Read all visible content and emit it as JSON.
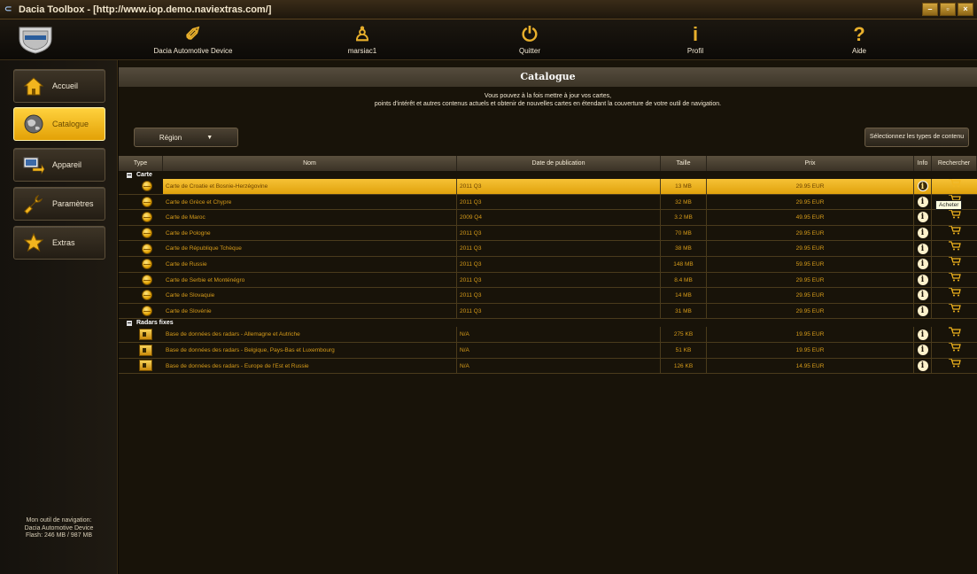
{
  "window": {
    "title": "Dacia Toolbox - [http://www.iop.demo.naviextras.com/]"
  },
  "toolbar": {
    "items": [
      {
        "label": "Dacia Automotive Device",
        "icon": "device-icon"
      },
      {
        "label": "marsiac1",
        "icon": "user-icon"
      },
      {
        "label": "Quitter",
        "icon": "power-icon"
      },
      {
        "label": "Profil",
        "icon": "info-icon"
      },
      {
        "label": "Aide",
        "icon": "help-icon"
      }
    ]
  },
  "sidebar": {
    "items": [
      {
        "label": "Accueil",
        "icon": "home-icon"
      },
      {
        "label": "Catalogue",
        "icon": "globe-icon",
        "active": true
      },
      {
        "label": "Appareil",
        "icon": "device-transfer-icon"
      },
      {
        "label": "Paramètres",
        "icon": "wrench-icon"
      },
      {
        "label": "Extras",
        "icon": "star-icon"
      }
    ],
    "device_info": {
      "line1": "Mon outil de navigation:",
      "line2": "Dacia Automotive Device",
      "line3": "Flash: 246 MB / 987 MB"
    }
  },
  "main": {
    "title": "Catalogue",
    "intro_line1": "Vous pouvez à la fois mettre à jour vos cartes,",
    "intro_line2": "points d'intérêt et autres contenus actuels et obtenir de nouvelles cartes en étendant la couverture de votre outil de navigation.",
    "region_button": "Région",
    "content_type_button": "Sélectionnez les types de contenu"
  },
  "table": {
    "columns": [
      "Type",
      "Nom",
      "Date de publication",
      "Taille",
      "Prix",
      "Info",
      "Rechercher"
    ],
    "groups": [
      {
        "label": "Carte",
        "rows": [
          {
            "name": "Carte de Croatie et Bosnie-Herzégovine",
            "date": "2011 Q3",
            "size": "13 MB",
            "price": "29.95 EUR",
            "selected": true
          },
          {
            "name": "Carte de Grèce et Chypre",
            "date": "2011 Q3",
            "size": "32 MB",
            "price": "29.95 EUR"
          },
          {
            "name": "Carte de Maroc",
            "date": "2009 Q4",
            "size": "3.2 MB",
            "price": "49.95 EUR"
          },
          {
            "name": "Carte de Pologne",
            "date": "2011 Q3",
            "size": "70 MB",
            "price": "29.95 EUR"
          },
          {
            "name": "Carte de République Tchèque",
            "date": "2011 Q3",
            "size": "38 MB",
            "price": "29.95 EUR"
          },
          {
            "name": "Carte de Russie",
            "date": "2011 Q3",
            "size": "148 MB",
            "price": "59.95 EUR"
          },
          {
            "name": "Carte de Serbie et Monténégro",
            "date": "2011 Q3",
            "size": "8.4 MB",
            "price": "29.95 EUR"
          },
          {
            "name": "Carte de Slovaquie",
            "date": "2011 Q3",
            "size": "14 MB",
            "price": "29.95 EUR"
          },
          {
            "name": "Carte de Slovénie",
            "date": "2011 Q3",
            "size": "31 MB",
            "price": "29.95 EUR"
          }
        ]
      },
      {
        "label": "Radars fixes",
        "rows": [
          {
            "name": "Base de données des radars - Allemagne et Autriche",
            "date": "N/A",
            "size": "275 KB",
            "price": "19.95 EUR"
          },
          {
            "name": "Base de données des radars - Belgique, Pays-Bas et Luxembourg",
            "date": "N/A",
            "size": "51 KB",
            "price": "19.95 EUR"
          },
          {
            "name": "Base de données des radars - Europe de l'Est et Russie",
            "date": "N/A",
            "size": "126 KB",
            "price": "14.95 EUR"
          }
        ]
      }
    ],
    "tooltip": "Acheter"
  }
}
